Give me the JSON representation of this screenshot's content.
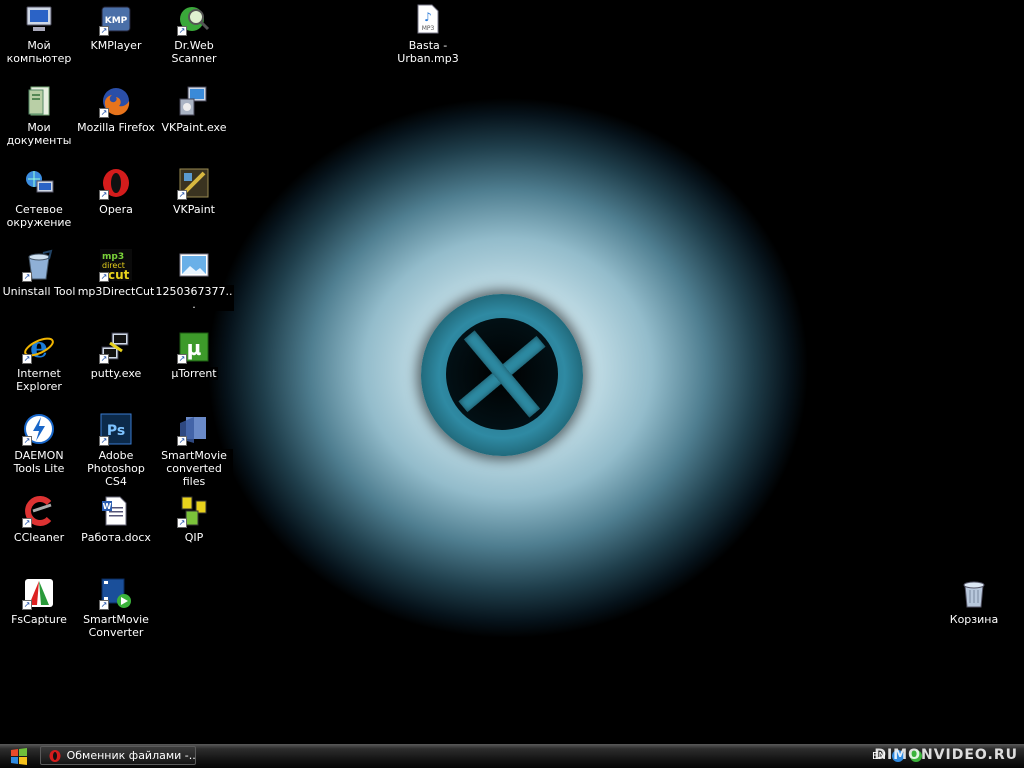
{
  "desktop": {
    "icons": [
      {
        "id": "my-computer",
        "label": "Мой компьютер"
      },
      {
        "id": "my-documents",
        "label": "Мои документы"
      },
      {
        "id": "network",
        "label": "Сетевое окружение"
      },
      {
        "id": "uninstall-tool",
        "label": "Uninstall Tool"
      },
      {
        "id": "internet-explorer",
        "label": "Internet Explorer"
      },
      {
        "id": "daemon-tools",
        "label": "DAEMON Tools Lite"
      },
      {
        "id": "ccleaner",
        "label": "CCleaner"
      },
      {
        "id": "fscapture",
        "label": "FsCapture"
      },
      {
        "id": "kmplayer",
        "label": "KMPlayer"
      },
      {
        "id": "firefox",
        "label": "Mozilla Firefox"
      },
      {
        "id": "opera",
        "label": "Opera"
      },
      {
        "id": "mp3directcut",
        "label": "mp3DirectCut"
      },
      {
        "id": "putty",
        "label": "putty.exe"
      },
      {
        "id": "photoshop",
        "label": "Adobe Photoshop CS4"
      },
      {
        "id": "rabota-docx",
        "label": "Работа.docx"
      },
      {
        "id": "smartmovie-converter",
        "label": "SmartMovie Converter"
      },
      {
        "id": "drweb",
        "label": "Dr.Web Scanner"
      },
      {
        "id": "vkpaint-exe",
        "label": "VKPaint.exe"
      },
      {
        "id": "vkpaint",
        "label": "VKPaint"
      },
      {
        "id": "image-file",
        "label": "1250367377..."
      },
      {
        "id": "utorrent",
        "label": "µTorrent"
      },
      {
        "id": "smartmovie-files",
        "label": "SmartMovie converted files"
      },
      {
        "id": "qip",
        "label": "QIP"
      },
      {
        "id": "basta-mp3",
        "label": "Basta - Urban.mp3"
      },
      {
        "id": "recycle-bin",
        "label": "Корзина"
      }
    ]
  },
  "taskbar": {
    "active_window": "Обменник файлами -...",
    "language": "EN",
    "watermark": "DIMONVIDEO.RU"
  },
  "colors": {
    "taskbar": "#161616",
    "label_text": "#ffffff",
    "drain": "#2d8aa2"
  }
}
